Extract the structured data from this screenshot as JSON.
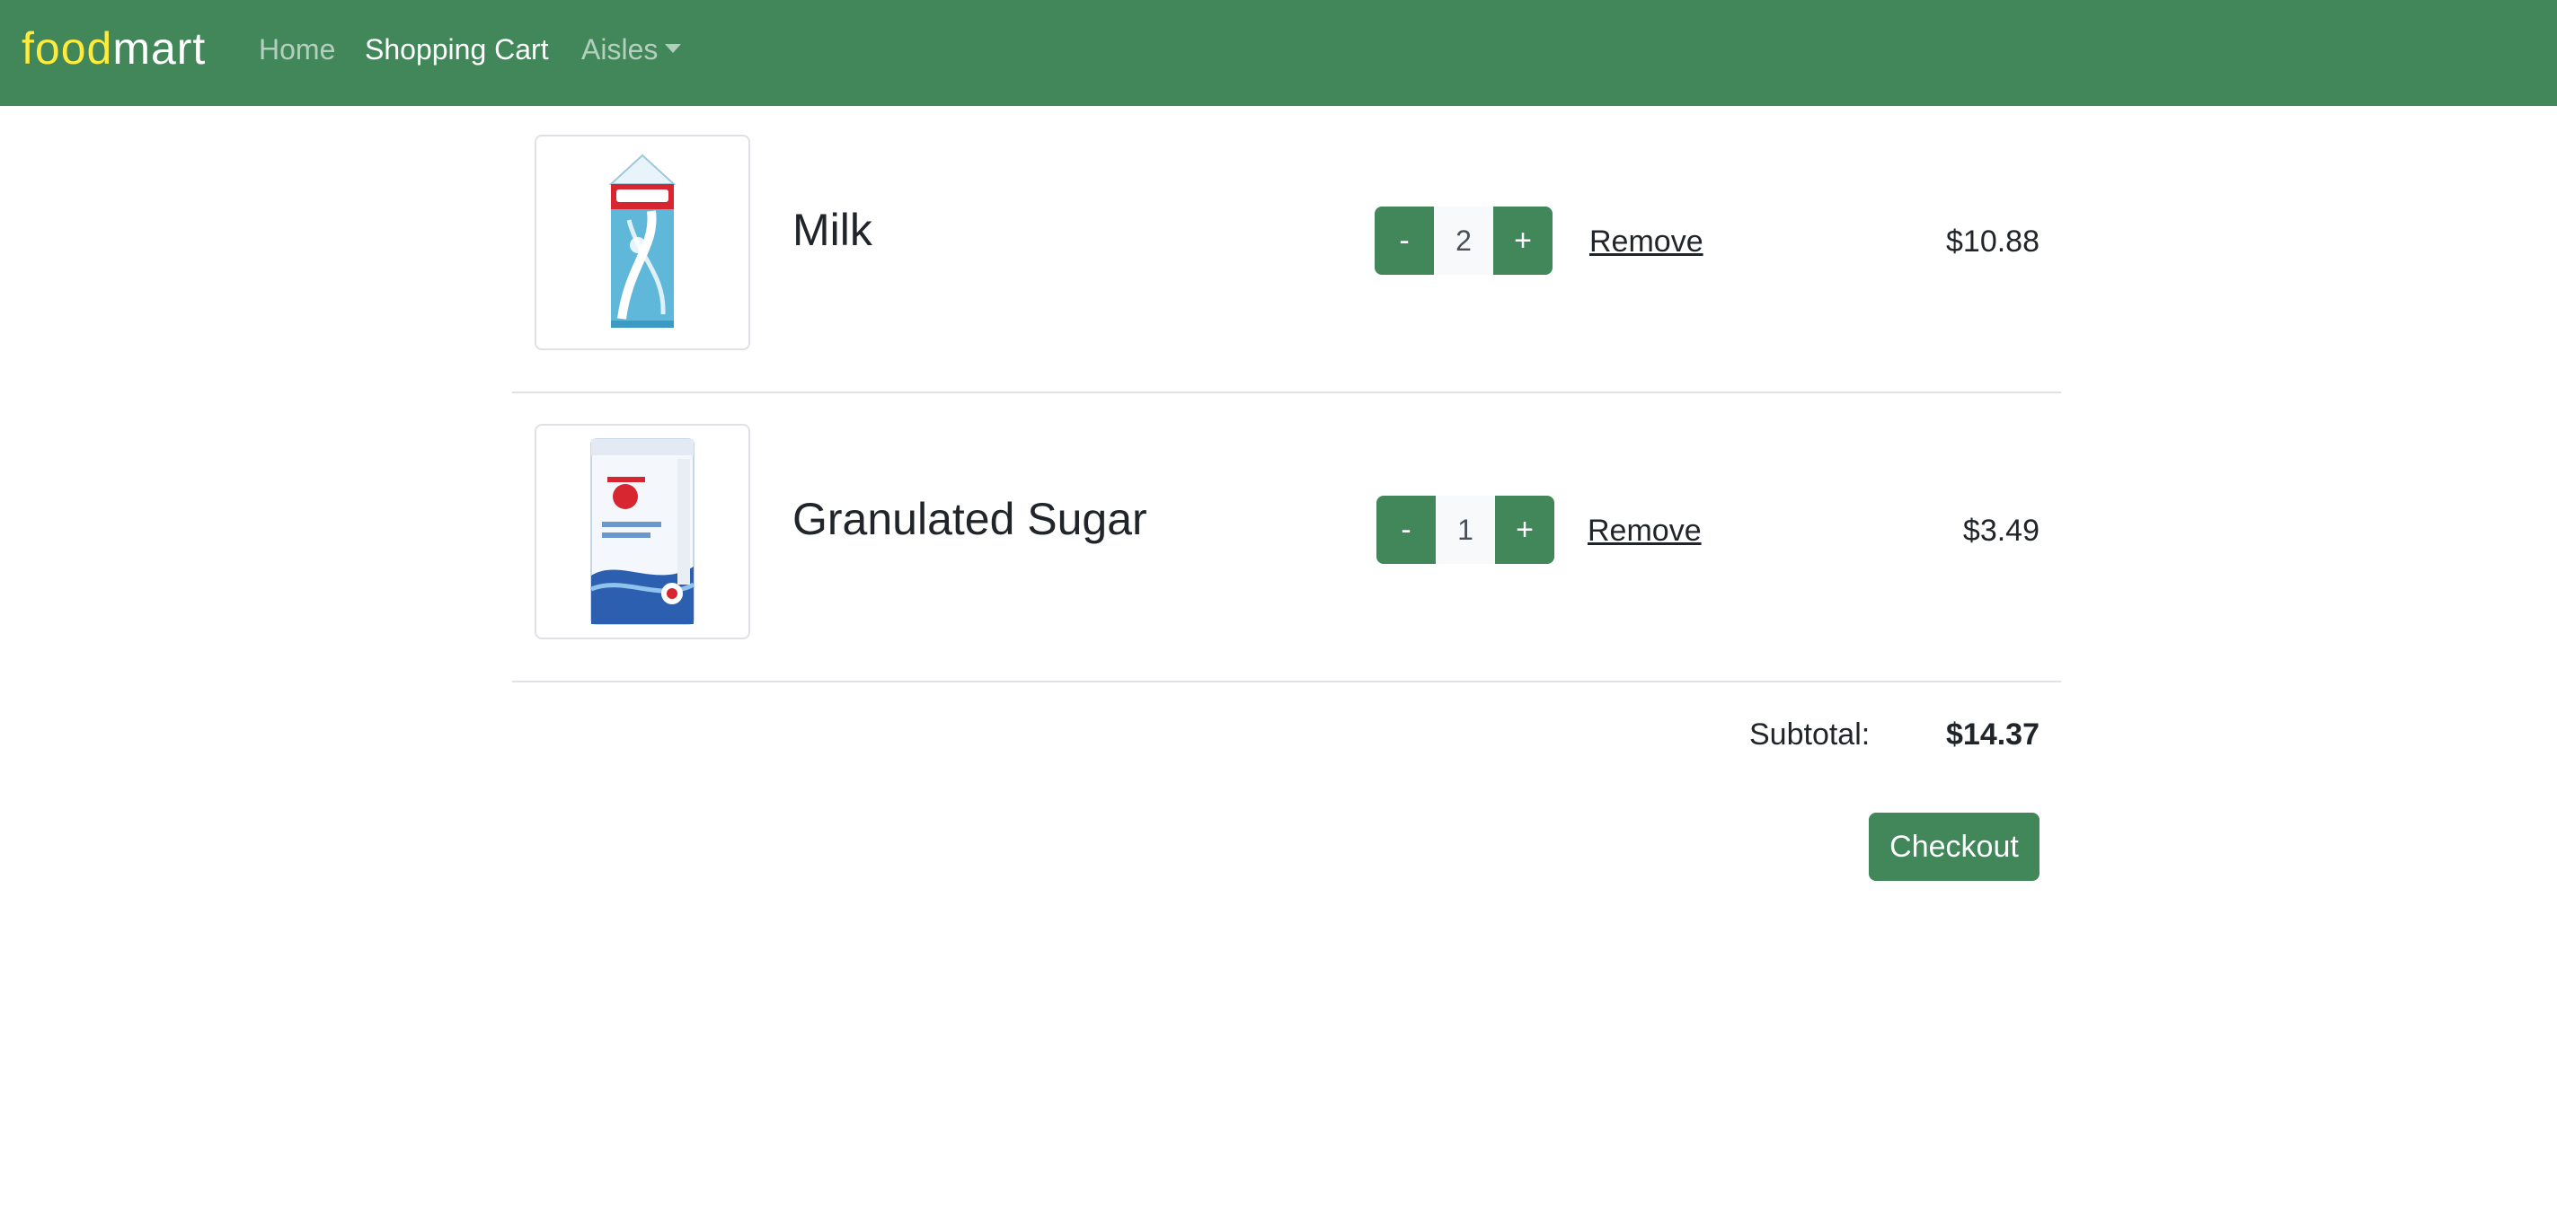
{
  "navbar": {
    "brand_food": "food",
    "brand_mart": "mart",
    "links": {
      "home": "Home",
      "cart": "Shopping Cart",
      "aisles": "Aisles"
    },
    "colors": {
      "background": "#41875a",
      "brand_accent": "#ffeb3b"
    }
  },
  "cart": {
    "items": [
      {
        "name": "Milk",
        "image_icon": "milk-carton-icon",
        "quantity": "2",
        "minus_label": "-",
        "plus_label": "+",
        "remove_label": "Remove",
        "price": "$10.88"
      },
      {
        "name": "Granulated Sugar",
        "image_icon": "sugar-bag-icon",
        "quantity": "1",
        "minus_label": "-",
        "plus_label": "+",
        "remove_label": "Remove",
        "price": "$3.49"
      }
    ],
    "subtotal_label": "Subtotal:",
    "subtotal_value": "$14.37",
    "checkout_label": "Checkout"
  }
}
